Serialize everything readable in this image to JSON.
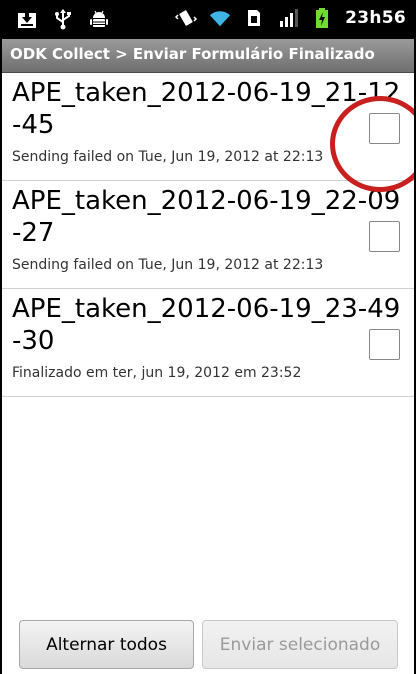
{
  "status_bar": {
    "time": "23h56",
    "icons": [
      "download-icon",
      "usb-icon",
      "android-debug-icon",
      "vibrate-icon",
      "wifi-icon",
      "sim-icon",
      "signal-icon",
      "battery-charging-icon"
    ]
  },
  "title_bar": {
    "title": "ODK Collect > Enviar Formulário Finalizado"
  },
  "forms": [
    {
      "title": "APE_taken_2012-06-19_21-12-45",
      "status": "Sending failed on Tue, Jun 19, 2012 at 22:13",
      "checked": false
    },
    {
      "title": "APE_taken_2012-06-19_22-09-27",
      "status": "Sending failed on Tue, Jun 19, 2012 at 22:13",
      "checked": false
    },
    {
      "title": "APE_taken_2012-06-19_23-49-30",
      "status": "Finalizado em ter, jun 19, 2012 em 23:52",
      "checked": false
    }
  ],
  "buttons": {
    "toggle_all": "Alternar todos",
    "send_selected": "Enviar selecionado"
  },
  "colors": {
    "annotation": "#c8201e",
    "title_bar": "#7f7f7f",
    "status_bar": "#000000"
  }
}
